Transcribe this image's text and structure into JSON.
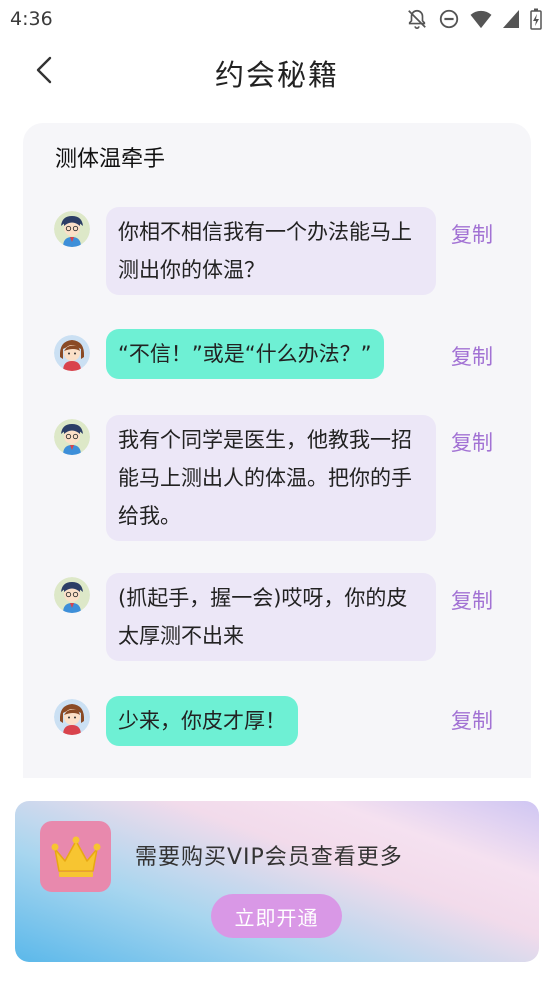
{
  "status_bar": {
    "time": "4:36",
    "icons": [
      "notifications-off-icon",
      "do-not-disturb-icon",
      "wifi-icon",
      "signal-icon",
      "battery-charging-icon"
    ]
  },
  "header": {
    "back_icon": "chevron-left-icon",
    "title": "约会秘籍"
  },
  "section": {
    "title": "测体温牵手"
  },
  "messages": [
    {
      "speaker": "boy",
      "text": "你相不相信我有一个办法能马上测出你的体温？",
      "copy": "复制"
    },
    {
      "speaker": "girl",
      "text": "“不信！”或是“什么办法？”",
      "copy": "复制"
    },
    {
      "speaker": "boy",
      "text": "我有个同学是医生，他教我一招能马上测出人的体温。把你的手给我。",
      "copy": "复制"
    },
    {
      "speaker": "boy",
      "text": "(抓起手，握一会)哎呀，你的皮太厚测不出来",
      "copy": "复制"
    },
    {
      "speaker": "girl",
      "text": "少来，你皮才厚！",
      "copy": "复制"
    }
  ],
  "vip": {
    "icon": "crown-icon",
    "text": "需要购买VIP会员查看更多",
    "button": "立即开通"
  },
  "colors": {
    "boy_bubble": "#ece7f7",
    "girl_bubble": "#6ef0d4",
    "copy_link": "#a272d4",
    "vip_button": "#d998e6",
    "crown_tile": "#e889ad"
  }
}
